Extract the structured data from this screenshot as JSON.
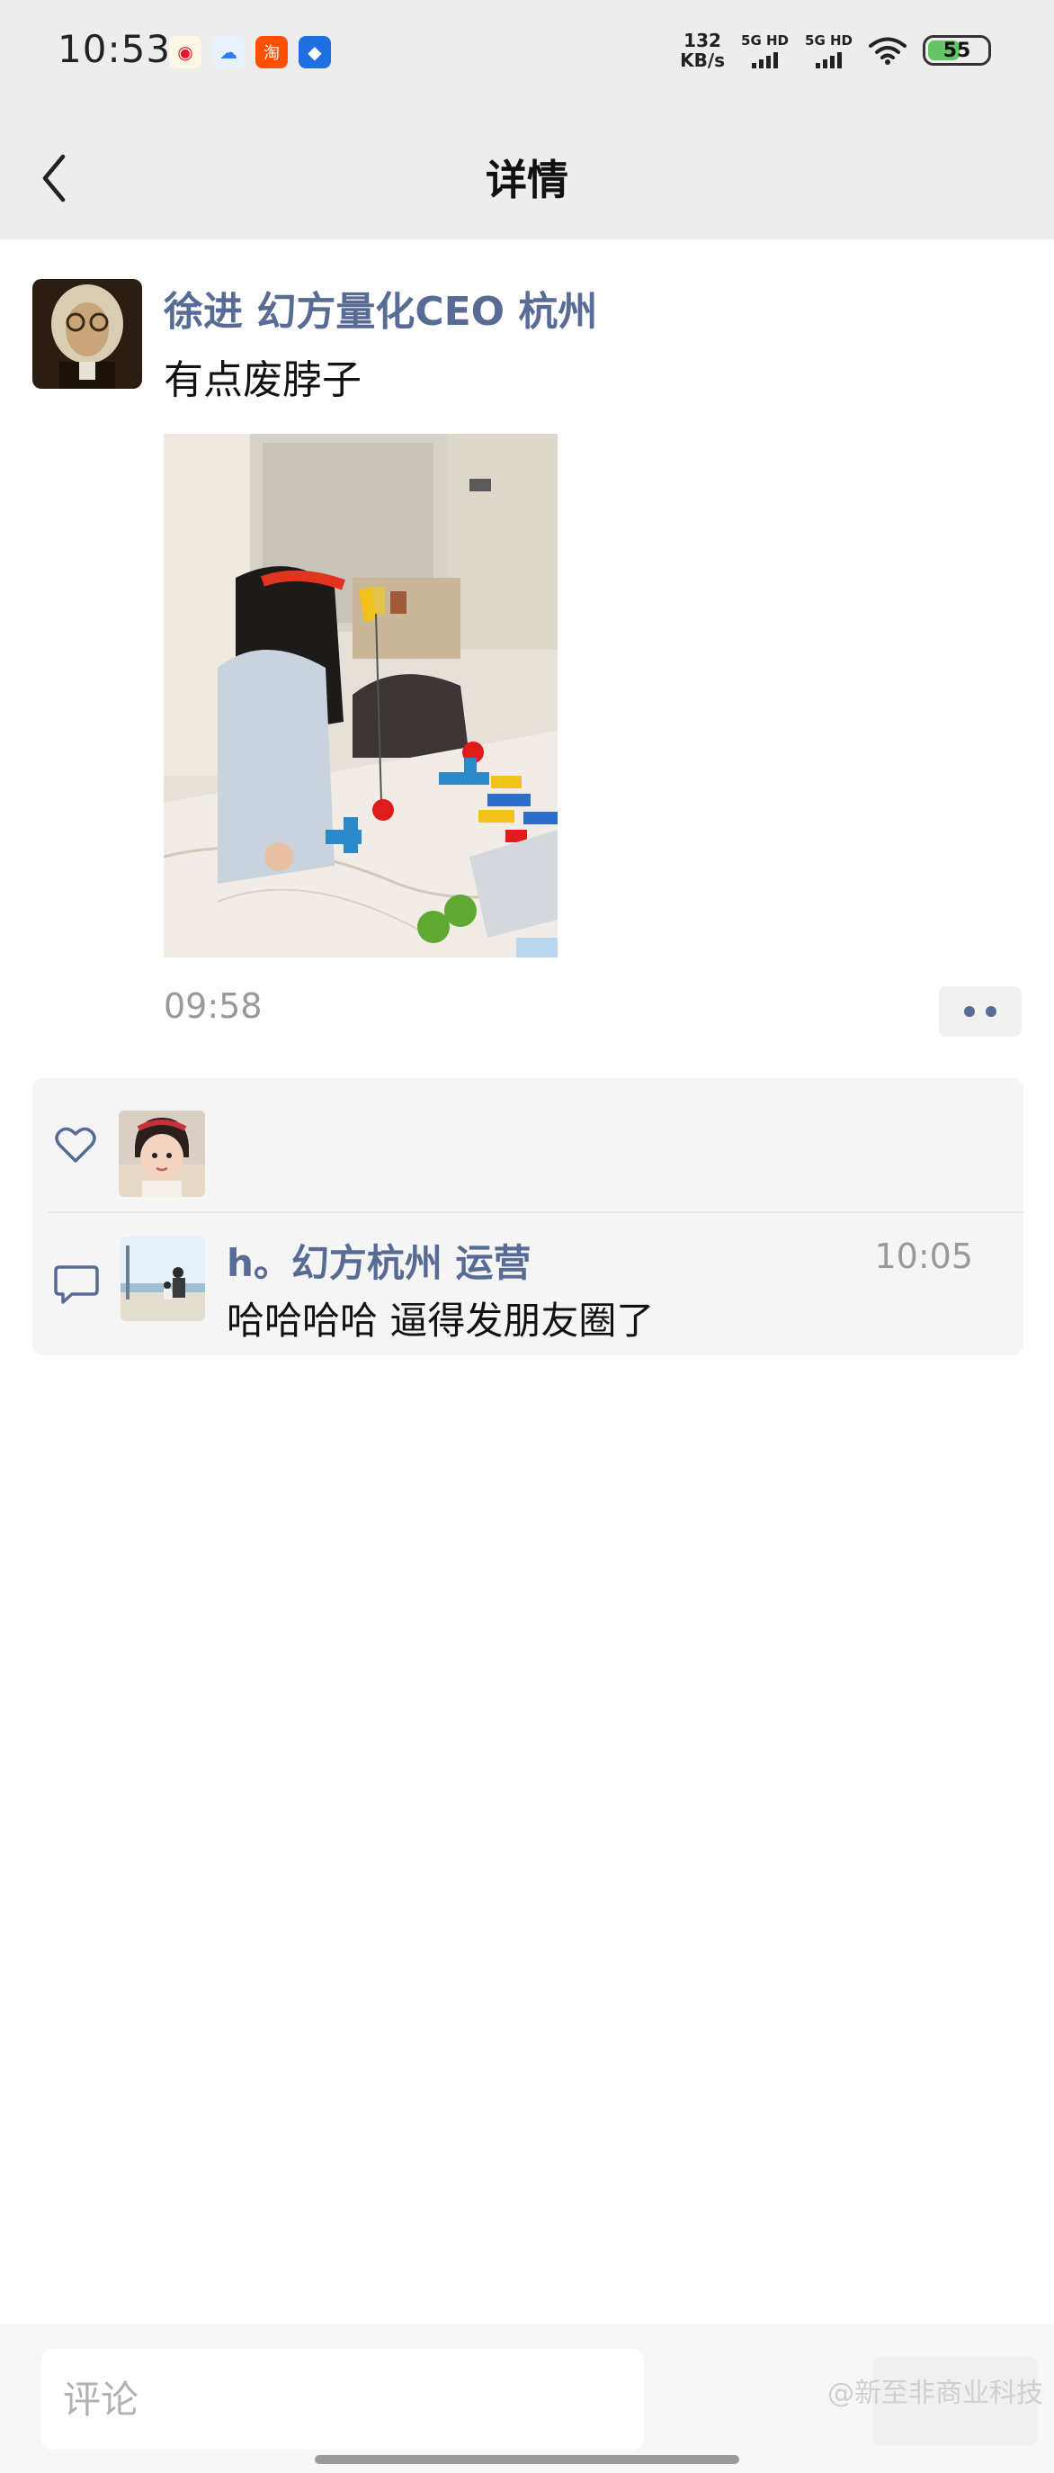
{
  "status_bar": {
    "time": "10:53",
    "app_icons": [
      {
        "name": "weibo-icon",
        "glyph": "◉",
        "color": "#f5a623"
      },
      {
        "name": "app-cloud-icon",
        "glyph": "☁",
        "color": "#2f7df6"
      },
      {
        "name": "taobao-icon",
        "glyph": "淘",
        "color": "#ff5000"
      },
      {
        "name": "app-robot-icon",
        "glyph": "◆",
        "color": "#1e6fe0"
      }
    ],
    "net_speed_value": "132",
    "net_speed_unit": "KB/s",
    "signal_1": "5G HD",
    "signal_2": "5G HD",
    "battery": "55",
    "battery_percent": 55
  },
  "header": {
    "title": "详情"
  },
  "post": {
    "author": "徐进 幻方量化CEO 杭州",
    "text": "有点废脖子",
    "time": "09:58"
  },
  "interactions": {
    "comment": {
      "author": "h。幻方杭州 运营",
      "time": "10:05",
      "text": "哈哈哈哈 逼得发朋友圈了"
    }
  },
  "bottom_bar": {
    "placeholder": "评论"
  },
  "watermark": "@新至非商业科技",
  "colors": {
    "name_link": "#576b95",
    "bar_background": "#ededed",
    "battery_fill": "#64c466"
  }
}
